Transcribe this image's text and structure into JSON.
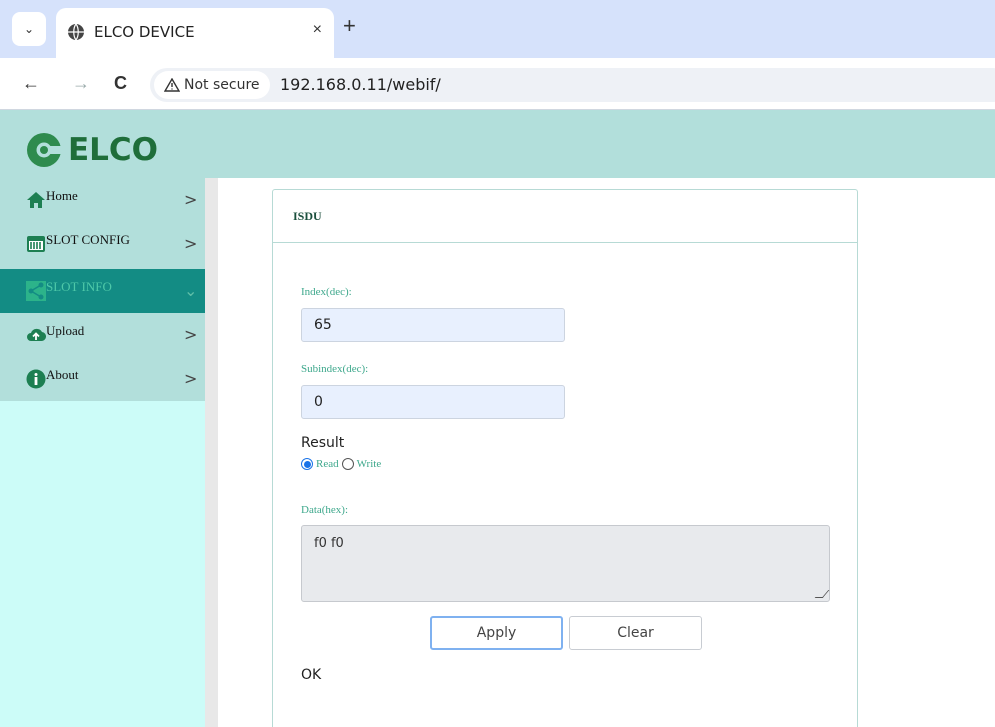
{
  "browser": {
    "tab_title": "ELCO DEVICE",
    "tab_close": "×",
    "new_tab": "+",
    "dropdown_glyph": "⌄",
    "back": "←",
    "forward": "→",
    "reload": "C",
    "security_label": "Not secure",
    "url": "192.168.0.11/webif/"
  },
  "brand": {
    "name": "ELCO",
    "color": "#1f6e3a"
  },
  "sidebar": {
    "items": [
      {
        "label": "Home",
        "icon": "home-icon",
        "chevron": ">"
      },
      {
        "label": "SLOT CONFIG",
        "icon": "slot-config-icon",
        "chevron": ">"
      },
      {
        "label": "SLOT INFO",
        "icon": "share-icon",
        "chevron": "⌄",
        "active": true
      },
      {
        "label": "Upload",
        "icon": "upload-cloud-icon",
        "chevron": ">"
      },
      {
        "label": "About",
        "icon": "info-icon",
        "chevron": ">"
      }
    ]
  },
  "panel": {
    "title": "ISDU",
    "index_label": "Index(dec):",
    "index_value": "65",
    "subindex_label": "Subindex(dec):",
    "subindex_value": "0",
    "result_label": "Result",
    "read_label": "Read",
    "write_label": "Write",
    "mode": "read",
    "data_label": "Data(hex):",
    "data_value": "f0 f0",
    "apply_label": "Apply",
    "clear_label": "Clear",
    "status": "OK"
  },
  "colors": {
    "header_bg": "#b2dfdb",
    "sidebar_bg": "#ccfcf8",
    "active_item_bg": "#138c84",
    "label_green": "#3ea88c"
  }
}
